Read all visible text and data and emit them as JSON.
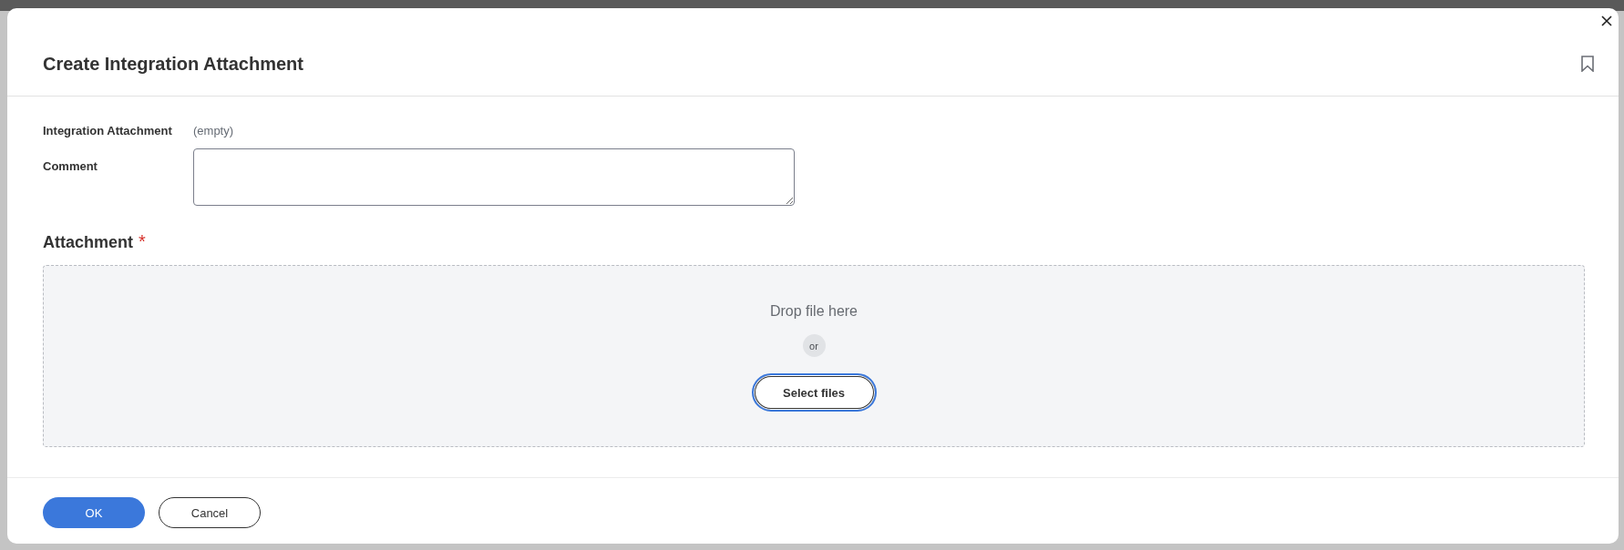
{
  "dialog": {
    "title": "Create Integration Attachment"
  },
  "fields": [
    {
      "kind": "readonly",
      "label": "Integration Attachment",
      "value": "(empty)"
    },
    {
      "kind": "textarea",
      "label": "Comment"
    }
  ],
  "attachment": {
    "heading": "Attachment",
    "required_mark": "*",
    "prompt": "Drop file here",
    "separator": "or",
    "select_button": {
      "label": "Select files",
      "focused": true
    }
  },
  "footer": {
    "buttons": [
      {
        "kind": "primary",
        "label": "OK"
      },
      {
        "kind": "secondary",
        "label": "Cancel"
      }
    ]
  }
}
